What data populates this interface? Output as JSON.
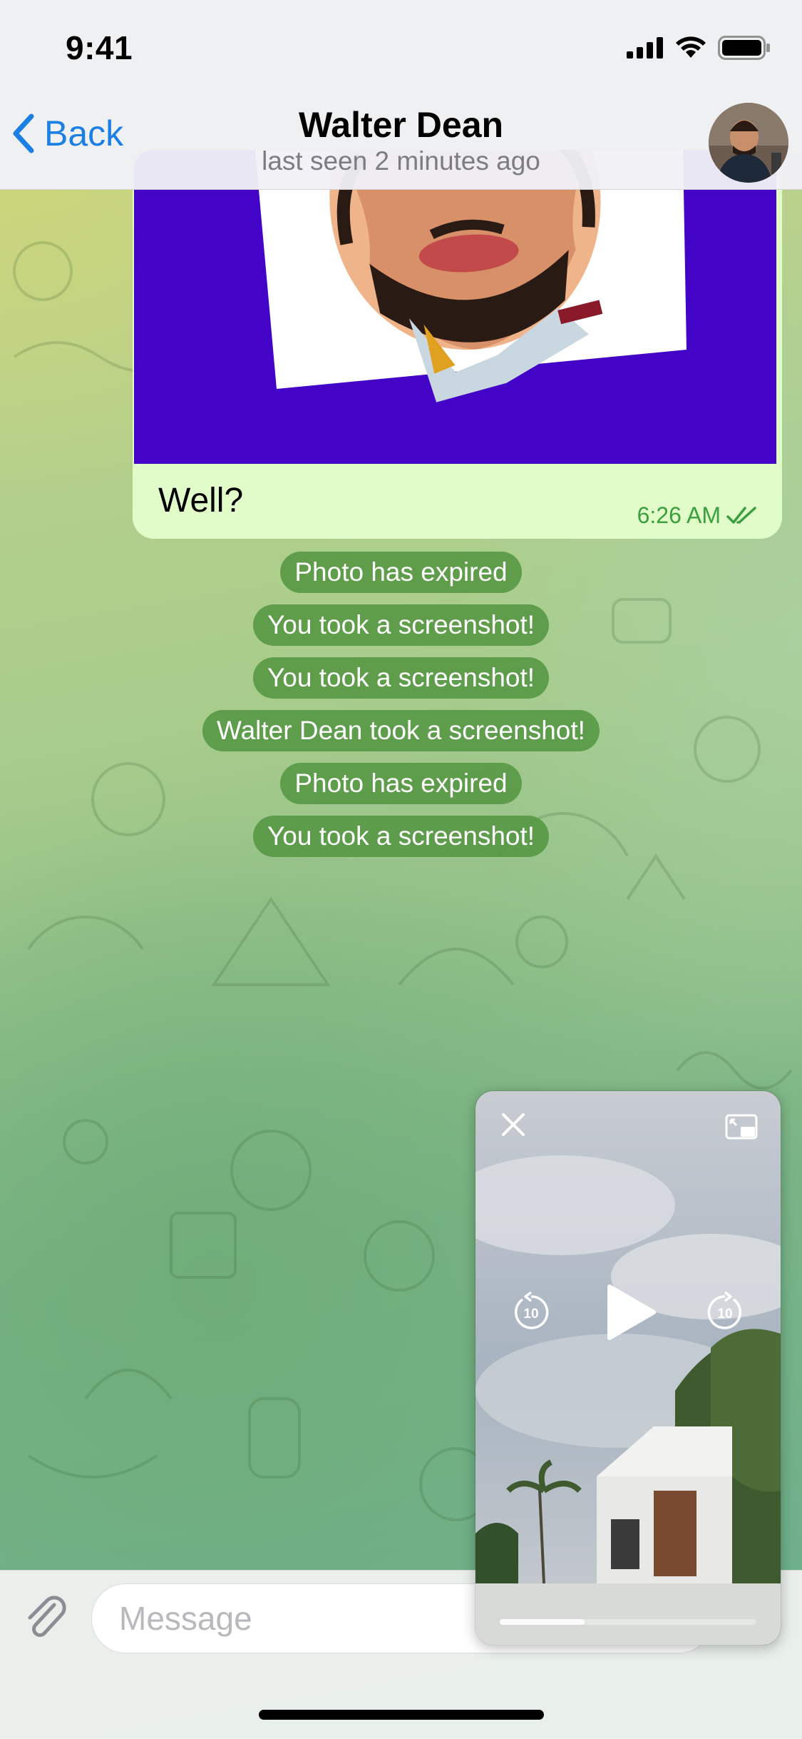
{
  "status_bar": {
    "time": "9:41",
    "icons": [
      "cellular-signal-icon",
      "wifi-icon",
      "battery-icon"
    ]
  },
  "header": {
    "back_label": "Back",
    "title": "Walter Dean",
    "subtitle": "last seen 2 minutes ago",
    "avatar_icon": "contact-avatar"
  },
  "bubble": {
    "text": "Well?",
    "time": "6:26 AM",
    "status_icon": "double-check-icon",
    "photo_icon": "stylized-portrait-photo"
  },
  "service_messages": [
    "Photo has expired",
    "You took a screenshot!",
    "You took a screenshot!",
    "Walter Dean took a screenshot!",
    "Photo has expired",
    "You took a screenshot!"
  ],
  "input": {
    "placeholder": "Message",
    "attach_icon": "paperclip-icon"
  },
  "pip": {
    "close_icon": "close-icon",
    "expand_icon": "picture-in-picture-expand-icon",
    "rewind_label": "10",
    "forward_label": "10",
    "play_icon": "play-icon",
    "progress": 0.33
  },
  "colors": {
    "accent": "#1c7fe6",
    "outgoing_bubble": "#e1fcc8",
    "service_bubble": "#549642",
    "check_green": "#3a9f3e"
  }
}
